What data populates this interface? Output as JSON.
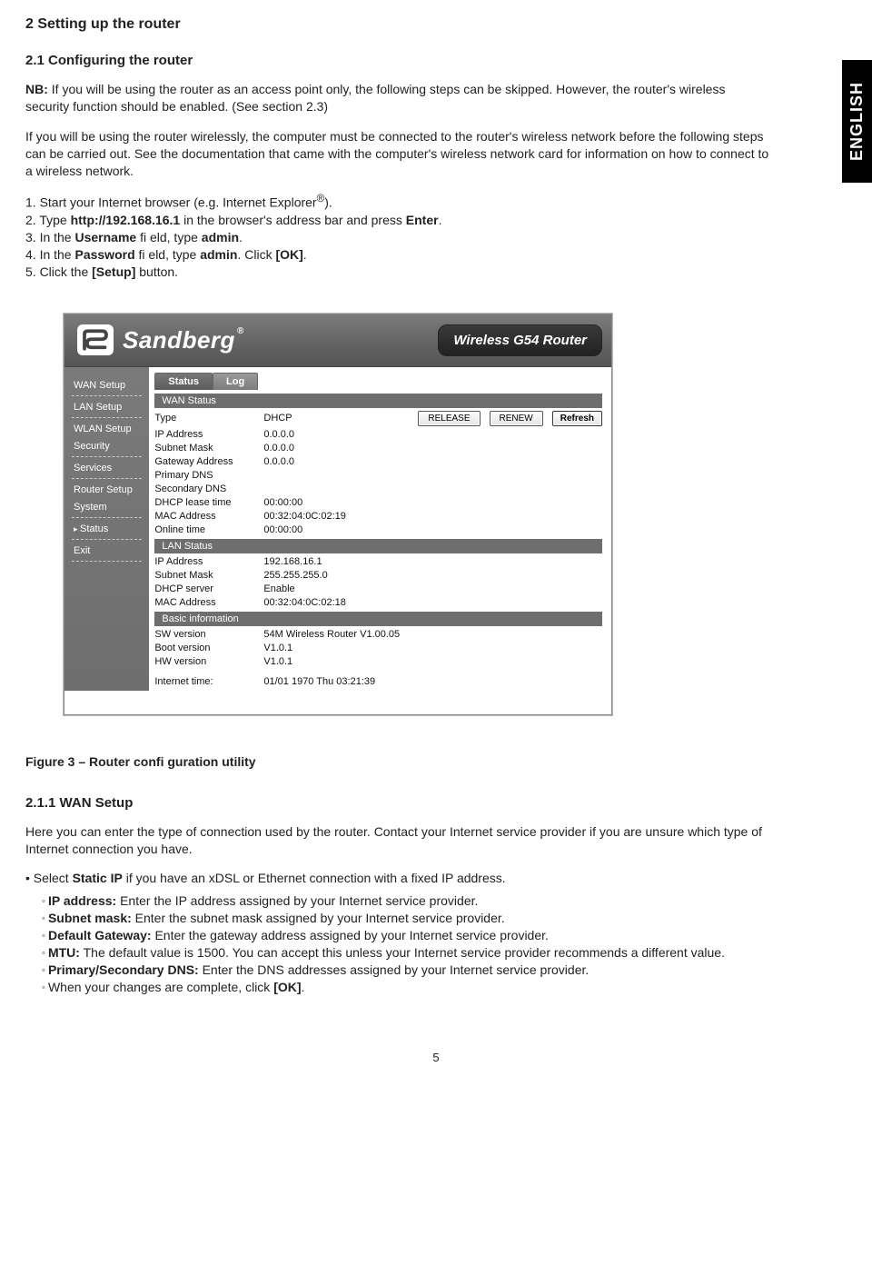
{
  "lang_tab": "ENGLISH",
  "sec_main": "2 Setting up the router",
  "sec_sub": "2.1 Configuring the router",
  "para_nb_label": "NB:",
  "para_nb_body": " If you will be using the router as an access point only, the following steps can be skipped. However, the router's wireless security function should be enabled. (See section 2.3)",
  "para_intro": "If you will be using the router wirelessly, the computer must be connected to the router's wireless network before the following steps can be carried out. See the documentation that came with the computer's wireless network card for information on how to connect to a wireless network.",
  "steps": {
    "s1_a": "1. Start your Internet browser (e.g. Internet Explorer",
    "s1_b": ").",
    "s2_a": "2. Type ",
    "s2_url": "http://192.168.16.1",
    "s2_b": " in the browser's address bar and press ",
    "s2_enter": "Enter",
    "s2_c": ".",
    "s3_a": "3. In the ",
    "s3_user": "Username",
    "s3_b": " fi eld, type ",
    "s3_admin": "admin",
    "s3_c": ".",
    "s4_a": "4. In the ",
    "s4_pw": "Password",
    "s4_b": " fi eld, type ",
    "s4_admin": "admin",
    "s4_c": ". Click ",
    "s4_ok": "[OK]",
    "s4_d": ".",
    "s5_a": "5. Click the ",
    "s5_setup": "[Setup]",
    "s5_b": " button."
  },
  "router": {
    "brand": "Sandberg",
    "product": "Wireless G54 Router",
    "sidebar": [
      "WAN Setup",
      "LAN Setup",
      "WLAN Setup",
      "Security",
      "Services",
      "Router Setup",
      "System",
      "Status",
      "Exit"
    ],
    "tabs": [
      "Status",
      "Log"
    ],
    "buttons": {
      "release": "RELEASE",
      "renew": "RENEW",
      "refresh": "Refresh"
    },
    "sections": {
      "wan_title": "WAN Status",
      "wan": [
        {
          "label": "Type",
          "value": "DHCP"
        },
        {
          "label": "IP Address",
          "value": "0.0.0.0"
        },
        {
          "label": "Subnet Mask",
          "value": "0.0.0.0"
        },
        {
          "label": "Gateway Address",
          "value": "0.0.0.0"
        },
        {
          "label": "Primary DNS",
          "value": ""
        },
        {
          "label": "Secondary DNS",
          "value": ""
        },
        {
          "label": "DHCP lease time",
          "value": "00:00:00"
        },
        {
          "label": "MAC Address",
          "value": "00:32:04:0C:02:19"
        },
        {
          "label": "Online time",
          "value": "00:00:00"
        }
      ],
      "lan_title": "LAN Status",
      "lan": [
        {
          "label": "IP Address",
          "value": "192.168.16.1"
        },
        {
          "label": "Subnet Mask",
          "value": "255.255.255.0"
        },
        {
          "label": "DHCP server",
          "value": "Enable"
        },
        {
          "label": "MAC Address",
          "value": "00:32:04:0C:02:18"
        }
      ],
      "basic_title": "Basic information",
      "basic": [
        {
          "label": "SW version",
          "value": "54M Wireless Router  V1.00.05"
        },
        {
          "label": "Boot version",
          "value": "V1.0.1"
        },
        {
          "label": "HW version",
          "value": "V1.0.1"
        }
      ],
      "time_label": "Internet time:",
      "time_value": "01/01 1970 Thu 03:21:39"
    }
  },
  "figure_caption": "Figure 3 – Router confi guration utility",
  "sec_211": "2.1.1 WAN Setup",
  "para_211": "Here you can enter the type of connection used by the router. Contact your Internet service provider if you are unsure which type of Internet connection you have.",
  "bullet_a": "• Select ",
  "bullet_static": "Static IP",
  "bullet_b": " if you have an xDSL or Ethernet connection with a fixed IP address.",
  "sub": {
    "ip_l": "IP address:",
    "ip_t": " Enter the IP address assigned by your Internet service provider.",
    "sm_l": "Subnet mask:",
    "sm_t": " Enter the subnet mask assigned by your Internet service provider.",
    "gw_l": "Default Gateway:",
    "gw_t": " Enter the gateway address assigned by your Internet service provider.",
    "mtu_l": "MTU:",
    "mtu_t": " The default value is 1500. You can accept this unless your Internet service provider recommends a different value.",
    "dns_l": "Primary/Secondary DNS:",
    "dns_t": " Enter the DNS addresses assigned by your Internet service provider.",
    "ok_a": "When your changes are complete, click ",
    "ok_b": "[OK]",
    "ok_c": "."
  },
  "page_number": "5"
}
